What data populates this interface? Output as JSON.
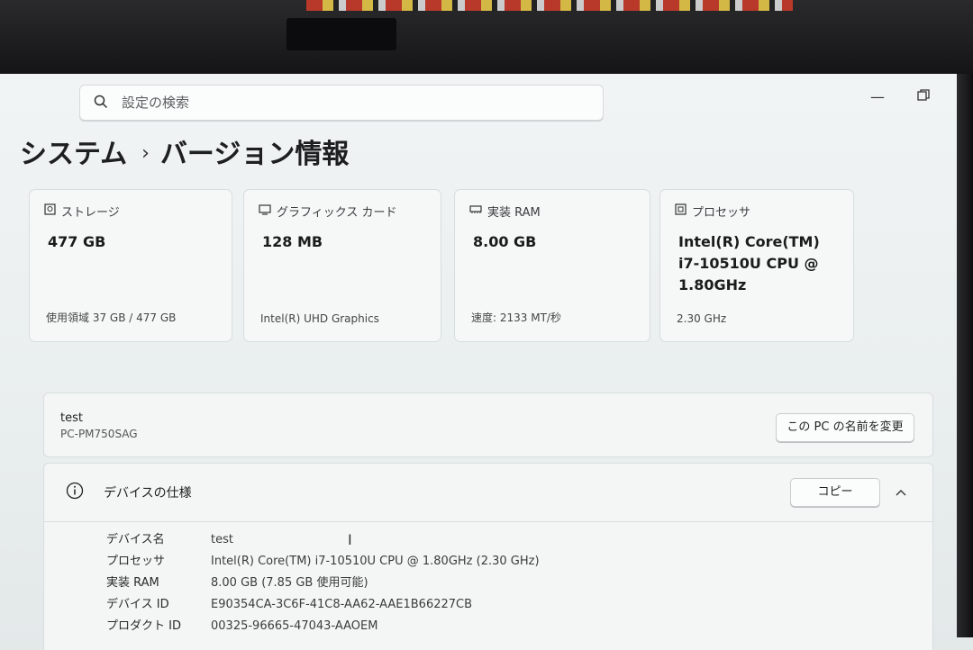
{
  "search": {
    "placeholder": "設定の検索"
  },
  "breadcrumb": {
    "parent": "システム",
    "separator": "›",
    "current": "バージョン情報"
  },
  "cards": [
    {
      "title": "ストレージ",
      "value": "477 GB",
      "detail": "使用領域 37 GB / 477 GB",
      "icon": "storage-icon"
    },
    {
      "title": "グラフィックス カード",
      "value": "128 MB",
      "detail": "Intel(R) UHD Graphics",
      "icon": "graphics-card-icon"
    },
    {
      "title": "実装 RAM",
      "value": "8.00 GB",
      "detail": "速度: 2133 MT/秒",
      "icon": "ram-icon"
    },
    {
      "title": "プロセッサ",
      "value_lines": [
        "Intel(R) Core(TM)",
        "i7-10510U CPU @",
        "1.80GHz"
      ],
      "detail": "2.30 GHz",
      "icon": "processor-icon"
    }
  ],
  "device": {
    "name": "test",
    "model": "PC-PM750SAG",
    "rename_label": "この PC の名前を変更"
  },
  "specs": {
    "title": "デバイスの仕様",
    "copy_label": "コピー",
    "rows": [
      {
        "key": "デバイス名",
        "value": "test"
      },
      {
        "key": "プロセッサ",
        "value": "Intel(R) Core(TM) i7-10510U CPU @ 1.80GHz (2.30 GHz)"
      },
      {
        "key": "実装 RAM",
        "value": "8.00 GB (7.85 GB 使用可能)"
      },
      {
        "key": "デバイス ID",
        "value": "E90354CA-3C6F-41C8-AA62-AAE1B66227CB"
      },
      {
        "key": "プロダクト ID",
        "value": "00325-96665-47043-AAOEM"
      }
    ]
  }
}
